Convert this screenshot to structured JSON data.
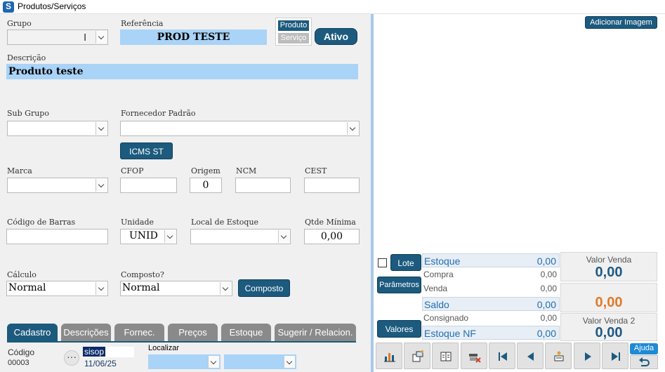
{
  "window": {
    "title": "Produtos/Serviços"
  },
  "form": {
    "grupo": {
      "label": "Grupo",
      "value": ""
    },
    "referencia": {
      "label": "Referência",
      "value": "PROD TESTE"
    },
    "tipo": {
      "produto": "Produto",
      "servico": "Serviço"
    },
    "status_button": "Ativo",
    "descricao": {
      "label": "Descrição",
      "value": "Produto teste"
    },
    "sub_grupo": {
      "label": "Sub Grupo",
      "value": ""
    },
    "fornecedor": {
      "label": "Fornecedor Padrão",
      "value": ""
    },
    "icms_button": "ICMS ST",
    "marca": {
      "label": "Marca",
      "value": ""
    },
    "cfop": {
      "label": "CFOP",
      "value": ""
    },
    "origem": {
      "label": "Origem",
      "value": "0"
    },
    "ncm": {
      "label": "NCM",
      "value": ""
    },
    "cest": {
      "label": "CEST",
      "value": ""
    },
    "codigo_barras": {
      "label": "Código de Barras",
      "value": ""
    },
    "unidade": {
      "label": "Unidade",
      "value": "UNID"
    },
    "local_estoque": {
      "label": "Local de Estoque",
      "value": ""
    },
    "qtde_minima": {
      "label": "Qtde Mínima",
      "value": "0,00"
    },
    "calculo": {
      "label": "Cálculo",
      "value": "Normal"
    },
    "composto": {
      "label": "Composto?",
      "value": "Normal"
    },
    "composto_button": "Composto"
  },
  "tabs": [
    {
      "label": "Cadastro",
      "active": true
    },
    {
      "label": "Descrições",
      "active": false
    },
    {
      "label": "Fornec.",
      "active": false
    },
    {
      "label": "Preços",
      "active": false
    },
    {
      "label": "Estoque",
      "active": false
    },
    {
      "label": "Sugerir / Relacion.",
      "active": false
    }
  ],
  "footer": {
    "codigo_label": "Código",
    "codigo_value": "00003",
    "user": "sisop",
    "date": "11/06/25",
    "localizar_label": "Localizar"
  },
  "right": {
    "add_image_button": "Adicionar Imagem",
    "lote_button": "Lote",
    "parametros_button": "Parâmetros",
    "valores_button": "Valores",
    "estoque": {
      "label": "Estoque",
      "value": "0,00"
    },
    "compra": {
      "label": "Compra",
      "value": "0,00"
    },
    "venda": {
      "label": "Venda",
      "value": "0,00"
    },
    "saldo": {
      "label": "Saldo",
      "value": "0,00"
    },
    "consignado": {
      "label": "Consignado",
      "value": "0,00"
    },
    "estoque_nf": {
      "label": "Estoque NF",
      "value": "0,00"
    },
    "valor_venda": {
      "label": "Valor Venda",
      "value": "0,00"
    },
    "valor_mid": {
      "value": "0,00"
    },
    "valor_venda2": {
      "label": "Valor Venda 2",
      "value": "0,00"
    },
    "ajuda_button": "Ajuda"
  },
  "colors": {
    "accent": "#1c5a7e",
    "field_blue": "#a9d3f7",
    "orange": "#e07a2a"
  }
}
